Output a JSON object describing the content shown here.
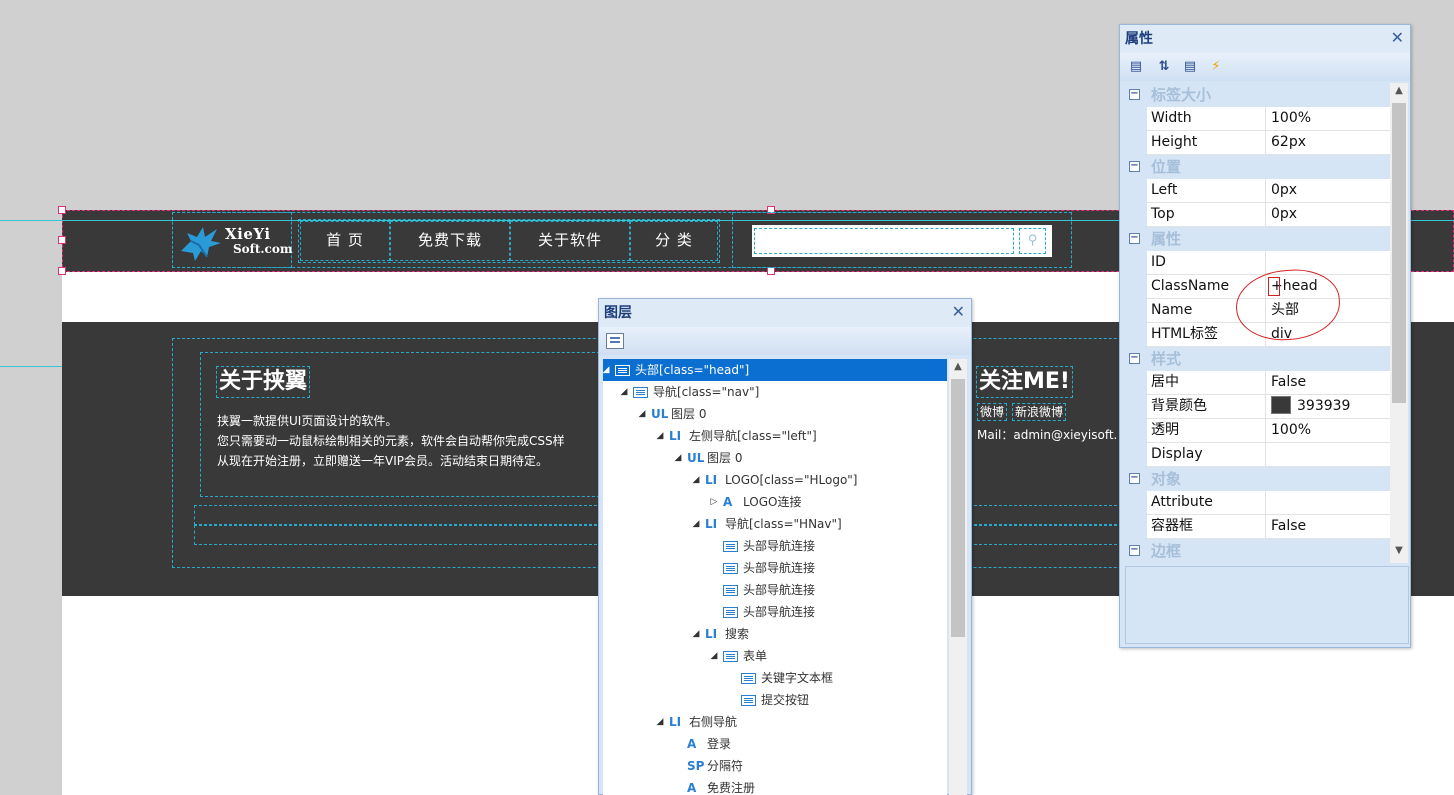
{
  "header": {
    "logo": {
      "line1": "XieYi",
      "line2": "Soft.com"
    },
    "nav": [
      "首 页",
      "免费下载",
      "关于软件",
      "分 类"
    ],
    "search_placeholder": ""
  },
  "about": {
    "title": "关于挟翼",
    "lines": [
      "挟翼一款提供UI页面设计的软件。",
      "您只需要动一动鼠标绘制相关的元素，软件会自动帮你完成CSS样",
      "从现在开始注册，立即赠送一年VIP会员。活动结束日期待定。"
    ]
  },
  "follow": {
    "title": "关注ME!",
    "links": [
      "微博",
      "新浪微博"
    ],
    "mail": "Mail：admin@xieyisoft.com"
  },
  "layers_panel": {
    "title": "图层",
    "close": "✕",
    "items": [
      {
        "icon": "box",
        "label": "头部[class=\"head\"]",
        "expanded": true,
        "selected": true
      },
      {
        "icon": "box",
        "label": "导航[class=\"nav\"]",
        "expanded": true
      },
      {
        "icon": "UL",
        "label": "图层 0",
        "expanded": true
      },
      {
        "icon": "LI",
        "label": "左侧导航[class=\"left\"]",
        "expanded": true
      },
      {
        "icon": "UL",
        "label": "图层 0",
        "expanded": true
      },
      {
        "icon": "LI",
        "label": "LOGO[class=\"HLogo\"]",
        "expanded": true
      },
      {
        "icon": "A",
        "label": "LOGO连接",
        "expanded": false
      },
      {
        "icon": "LI",
        "label": "导航[class=\"HNav\"]",
        "expanded": true
      },
      {
        "icon": "box",
        "label": "头部导航连接"
      },
      {
        "icon": "box",
        "label": "头部导航连接"
      },
      {
        "icon": "box",
        "label": "头部导航连接"
      },
      {
        "icon": "box",
        "label": "头部导航连接"
      },
      {
        "icon": "LI",
        "label": "搜索",
        "expanded": true
      },
      {
        "icon": "box",
        "label": "表单",
        "expanded": true
      },
      {
        "icon": "abc",
        "label": "关键字文本框"
      },
      {
        "icon": "btn",
        "label": "提交按钮"
      },
      {
        "icon": "LI",
        "label": "右侧导航",
        "expanded": true
      },
      {
        "icon": "A",
        "label": "登录"
      },
      {
        "icon": "SP",
        "label": "分隔符"
      },
      {
        "icon": "A",
        "label": "免费注册"
      }
    ]
  },
  "properties_panel": {
    "title": "属性",
    "close": "✕",
    "categories": [
      {
        "name": "标签大小",
        "rows": [
          {
            "name": "Width",
            "value": "100%"
          },
          {
            "name": "Height",
            "value": "62px"
          }
        ]
      },
      {
        "name": "位置",
        "rows": [
          {
            "name": "Left",
            "value": "0px"
          },
          {
            "name": "Top",
            "value": "0px"
          }
        ]
      },
      {
        "name": "属性",
        "rows": [
          {
            "name": "ID",
            "value": ""
          },
          {
            "name": "ClassName",
            "value": "+head"
          },
          {
            "name": "Name",
            "value": "头部"
          },
          {
            "name": "HTML标签",
            "value": "div"
          }
        ]
      },
      {
        "name": "样式",
        "rows": [
          {
            "name": "居中",
            "value": "False"
          },
          {
            "name": "背景颜色",
            "value": "393939",
            "swatch": "#393939"
          },
          {
            "name": "透明",
            "value": "100%"
          },
          {
            "name": "Display",
            "value": ""
          }
        ]
      },
      {
        "name": "对象",
        "rows": [
          {
            "name": "Attribute",
            "value": ""
          },
          {
            "name": "容器框",
            "value": "False"
          }
        ]
      },
      {
        "name": "边框",
        "rows": []
      }
    ]
  },
  "colors": {
    "accent": "#0a6fd1",
    "head_bg": "#393939",
    "guide": "#36c6d3",
    "selection": "#e0307a",
    "annotation": "#d32020"
  }
}
